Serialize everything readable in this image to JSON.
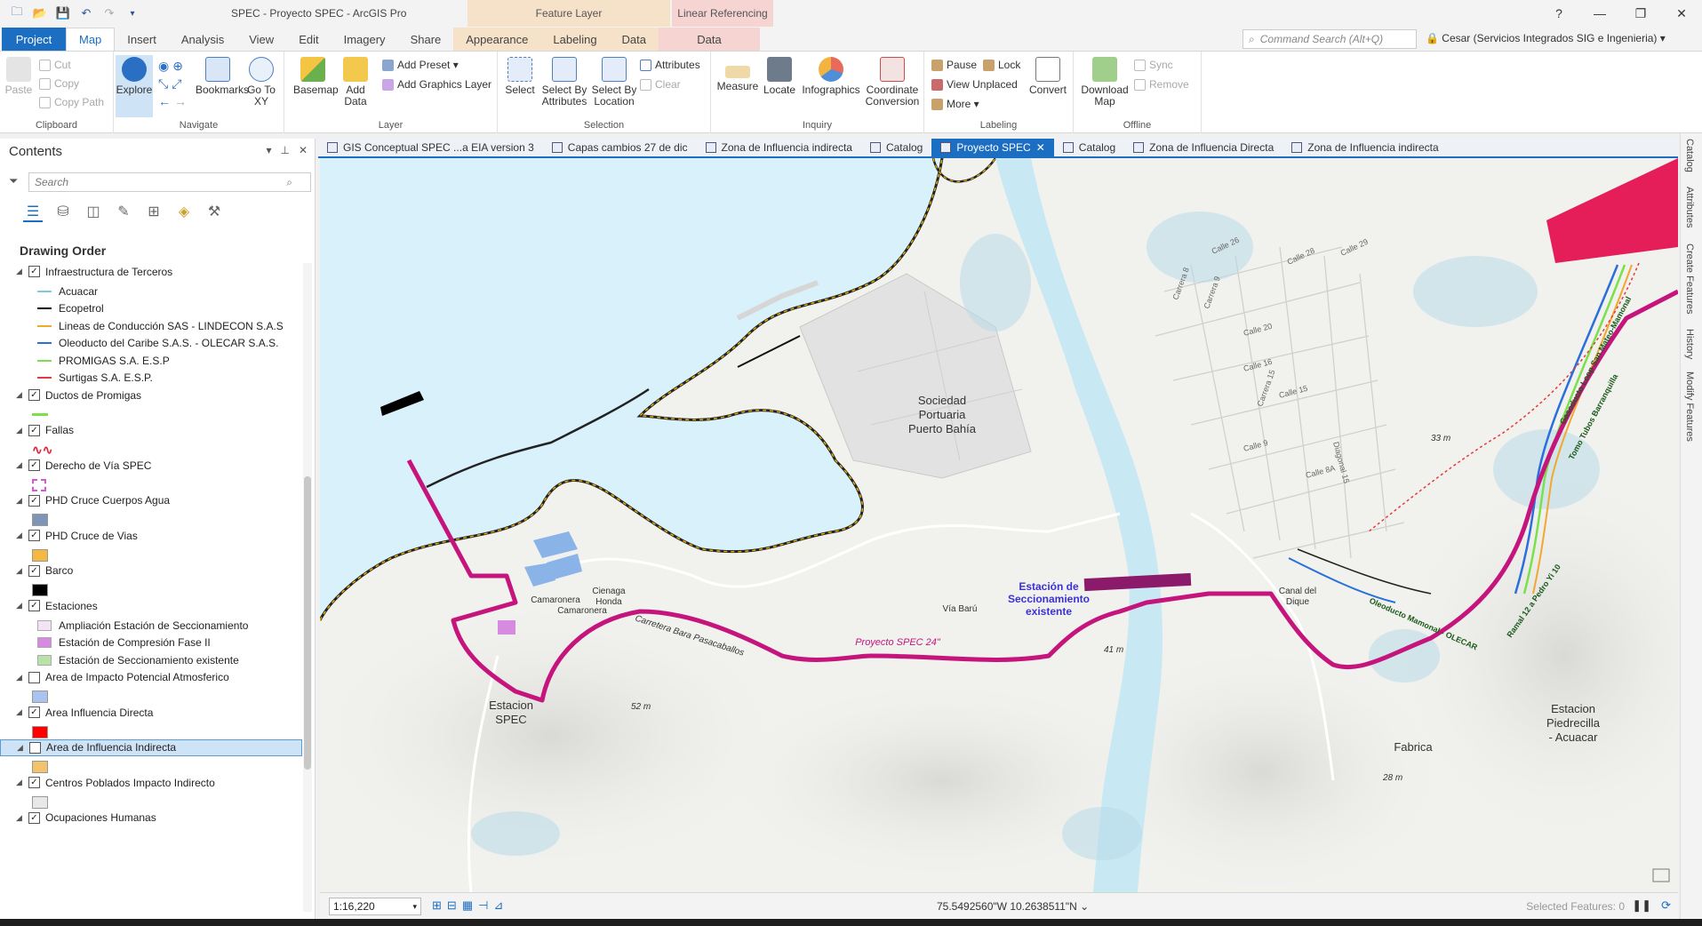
{
  "window": {
    "title": "SPEC - Proyecto SPEC - ArcGIS Pro",
    "help": "?",
    "minimize": "—",
    "restore": "❐",
    "close": "✕"
  },
  "contextual": {
    "feature_layer": "Feature Layer",
    "linear_referencing": "Linear Referencing"
  },
  "tabs": [
    "Project",
    "Map",
    "Insert",
    "Analysis",
    "View",
    "Edit",
    "Imagery",
    "Share",
    "Appearance",
    "Labeling",
    "Data",
    "Data"
  ],
  "command_search": {
    "placeholder": "Command Search (Alt+Q)"
  },
  "user": "Cesar (Servicios Integrados SIG e Ingenieria) ▾",
  "ribbon": {
    "clipboard": {
      "label": "Clipboard",
      "paste": "Paste",
      "cut": "Cut",
      "copy": "Copy",
      "copy_path": "Copy Path"
    },
    "navigate": {
      "label": "Navigate",
      "explore": "Explore",
      "bookmarks": "Bookmarks",
      "go_to_xy": "Go To XY"
    },
    "layer": {
      "label": "Layer",
      "basemap": "Basemap",
      "add_data": "Add Data",
      "add_preset": "Add Preset ▾",
      "add_graphics_layer": "Add Graphics Layer"
    },
    "selection": {
      "label": "Selection",
      "select": "Select",
      "select_by_attributes": "Select By Attributes",
      "select_by_location": "Select By Location",
      "attributes": "Attributes",
      "clear": "Clear"
    },
    "inquiry": {
      "label": "Inquiry",
      "measure": "Measure",
      "locate": "Locate",
      "infographics": "Infographics",
      "coordinate_conversion": "Coordinate Conversion"
    },
    "labeling": {
      "label": "Labeling",
      "pause": "Pause",
      "lock": "Lock",
      "view_unplaced": "View Unplaced",
      "more": "More ▾",
      "convert": "Convert"
    },
    "offline": {
      "label": "Offline",
      "download_map": "Download Map",
      "sync": "Sync",
      "remove": "Remove"
    }
  },
  "contents": {
    "title": "Contents",
    "search_placeholder": "Search",
    "drawing_order": "Drawing Order",
    "items": [
      {
        "label": "Infraestructura de Terceros",
        "kind": "layer",
        "checked": true
      },
      {
        "label": "Acuacar",
        "kind": "legend",
        "color": "#7ec8e3"
      },
      {
        "label": "Ecopetrol",
        "kind": "legend",
        "color": "#000000"
      },
      {
        "label": "Lineas de Conducción SAS - LINDECON S.A.S",
        "kind": "legend",
        "color": "#f0a830"
      },
      {
        "label": "Oleoducto del Caribe S.A.S. - OLECAR S.A.S.",
        "kind": "legend",
        "color": "#2a6fdb"
      },
      {
        "label": "PROMIGAS S.A. E.S.P",
        "kind": "legend",
        "color": "#7be04a"
      },
      {
        "label": "Surtigas S.A. E.S.P.",
        "kind": "legend",
        "color": "#e33b3b"
      },
      {
        "label": "Ductos de Promigas",
        "kind": "layer",
        "checked": true
      },
      {
        "label": "",
        "kind": "sym-line",
        "color": "#7be04a"
      },
      {
        "label": "Fallas",
        "kind": "layer",
        "checked": true
      },
      {
        "label": "",
        "kind": "sym-wave",
        "color": "#e0243c"
      },
      {
        "label": "Derecho de Vía SPEC",
        "kind": "layer",
        "checked": true
      },
      {
        "label": "",
        "kind": "sym-dash",
        "color": "#d35ad0"
      },
      {
        "label": "PHD Cruce Cuerpos Agua",
        "kind": "layer",
        "checked": true
      },
      {
        "label": "",
        "kind": "sym-box",
        "color": "#8094b8"
      },
      {
        "label": "PHD Cruce de Vias",
        "kind": "layer",
        "checked": true
      },
      {
        "label": "",
        "kind": "sym-box",
        "color": "#f5b840"
      },
      {
        "label": "Barco",
        "kind": "layer",
        "checked": true
      },
      {
        "label": "",
        "kind": "sym-box",
        "color": "#000000"
      },
      {
        "label": "Estaciones",
        "kind": "layer",
        "checked": true
      },
      {
        "label": "Ampliación Estación de Seccionamiento",
        "kind": "legend-box",
        "color": "#f2e4f5"
      },
      {
        "label": "Estación de Compresión Fase II",
        "kind": "legend-box",
        "color": "#d78be0"
      },
      {
        "label": "Estación de Seccionamiento existente",
        "kind": "legend-box",
        "color": "#b9e3a6"
      },
      {
        "label": "Area de Impacto Potencial Atmosferico",
        "kind": "layer",
        "checked": false
      },
      {
        "label": "",
        "kind": "sym-box",
        "color": "#a9c3ee"
      },
      {
        "label": "Area Influencia Directa",
        "kind": "layer",
        "checked": true
      },
      {
        "label": "",
        "kind": "sym-box",
        "color": "#ff0000"
      },
      {
        "label": "Area de Influencia Indirecta",
        "kind": "layer",
        "checked": false,
        "selected": true
      },
      {
        "label": "",
        "kind": "sym-box",
        "color": "#f2c36b"
      },
      {
        "label": "Centros Poblados Impacto Indirecto",
        "kind": "layer",
        "checked": true
      },
      {
        "label": "",
        "kind": "sym-box",
        "color": "#e8e8e8"
      },
      {
        "label": "Ocupaciones Humanas",
        "kind": "layer",
        "checked": true
      }
    ]
  },
  "map_tabs": [
    {
      "label": "GIS Conceptual SPEC ...a EIA version 3",
      "active": false
    },
    {
      "label": "Capas cambios 27 de dic",
      "active": false
    },
    {
      "label": "Zona de Influencia indirecta",
      "active": false
    },
    {
      "label": "Catalog",
      "active": false
    },
    {
      "label": "Proyecto SPEC",
      "active": true
    },
    {
      "label": "Catalog",
      "active": false
    },
    {
      "label": "Zona de Influencia Directa",
      "active": false
    },
    {
      "label": "Zona de Influencia indirecta",
      "active": false
    }
  ],
  "map_labels": {
    "sociedad": [
      "Sociedad",
      "Portuaria",
      "Puerto Bahía"
    ],
    "estacion_spec": [
      "Estacion",
      "SPEC"
    ],
    "estacion_piedrecilla": [
      "Estacion",
      "Piedrecilla",
      "- Acuacar"
    ],
    "fabrica": "Fabrica",
    "canal": [
      "Canal del",
      "Dique"
    ],
    "cienaga": [
      "Cienaga",
      "Honda"
    ],
    "camaronera": "Camaronera",
    "estacion_secc": [
      "Estación de",
      "Seccionamiento",
      "existente"
    ],
    "proyecto_spec": "Proyecto SPEC 24\"",
    "via_baru": "Vía Barú",
    "carretera": "Carretera Bara Pasacaballos",
    "elev_52": "52 m",
    "elev_41": "41 m",
    "elev_33": "33 m",
    "elev_28": "28 m",
    "gasoducto": "Gasoducto Loop San Mateo-Mamonal",
    "tomo": "Tomo Tubos Barranquilla",
    "oleoducto": "Oleoducto Mamonal - OLECAR",
    "ramal": "Ramal 12 a Pedro Yi 10",
    "calles": [
      "Calle 26",
      "Calle 28",
      "Calle 29",
      "Calle 20",
      "Calle 16",
      "Calle 15",
      "Calle 9",
      "Calle 8A",
      "Carrera 8",
      "Carrera 9",
      "Carrera 15",
      "Diagonal 15"
    ]
  },
  "status": {
    "scale": "1:16,220",
    "coordinates": "75.5492560\"W 10.2638511\"N",
    "selected_features": "Selected Features: 0"
  },
  "right_dock": [
    "Catalog",
    "Attributes",
    "Create Features",
    "History",
    "Modify Features"
  ]
}
